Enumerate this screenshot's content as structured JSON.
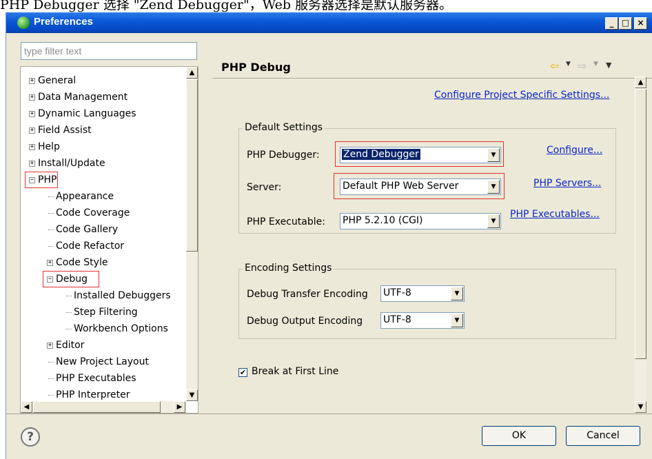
{
  "caption": "PHP Debugger 选择 \"Zend Debugger\"，Web 服务器选择是默认服务器。",
  "window": {
    "title": "Preferences",
    "minimize_glyph": "_",
    "maximize_glyph": "□",
    "close_glyph": "×"
  },
  "filter": {
    "placeholder": "type filter text"
  },
  "tree": {
    "items": [
      {
        "label": "General",
        "expander": "+"
      },
      {
        "label": "Data Management",
        "expander": "+"
      },
      {
        "label": "Dynamic Languages",
        "expander": "+"
      },
      {
        "label": "Field Assist",
        "expander": "+"
      },
      {
        "label": "Help",
        "expander": "+"
      },
      {
        "label": "Install/Update",
        "expander": "+"
      },
      {
        "label": "PHP",
        "expander": "−",
        "highlighted": true
      },
      {
        "label": "Appearance"
      },
      {
        "label": "Code Coverage"
      },
      {
        "label": "Code Gallery"
      },
      {
        "label": "Code Refactor"
      },
      {
        "label": "Code Style",
        "expander": "+"
      },
      {
        "label": "Debug",
        "expander": "−",
        "highlighted": true
      },
      {
        "label": "Installed Debuggers"
      },
      {
        "label": "Step Filtering"
      },
      {
        "label": "Workbench Options"
      },
      {
        "label": "Editor",
        "expander": "+"
      },
      {
        "label": "New Project Layout"
      },
      {
        "label": "PHP Executables"
      },
      {
        "label": "PHP Interpreter"
      }
    ]
  },
  "page": {
    "title": "PHP Debug",
    "project_settings_link": "Configure Project Specific Settings...",
    "default_settings": {
      "group_label": "Default Settings",
      "debugger_label": "PHP Debugger:",
      "debugger_value": "Zend Debugger",
      "configure_link": "Configure...",
      "server_label": "Server:",
      "server_value": "Default PHP Web Server",
      "servers_link": "PHP Servers...",
      "executable_label": "PHP Executable:",
      "executable_value": "PHP 5.2.10 (CGI)",
      "executables_link": "PHP Executables..."
    },
    "encoding_settings": {
      "group_label": "Encoding Settings",
      "transfer_label": "Debug Transfer Encoding",
      "transfer_value": "UTF-8",
      "output_label": "Debug Output Encoding",
      "output_value": "UTF-8"
    },
    "break_first_line": {
      "label": "Break at First Line",
      "checked": true
    }
  },
  "buttons": {
    "ok": "OK",
    "cancel": "Cancel",
    "help": "?"
  },
  "colors": {
    "highlight_box": "#e03030",
    "link": "#0a26c8",
    "titlebar": "#0a5ad8"
  }
}
